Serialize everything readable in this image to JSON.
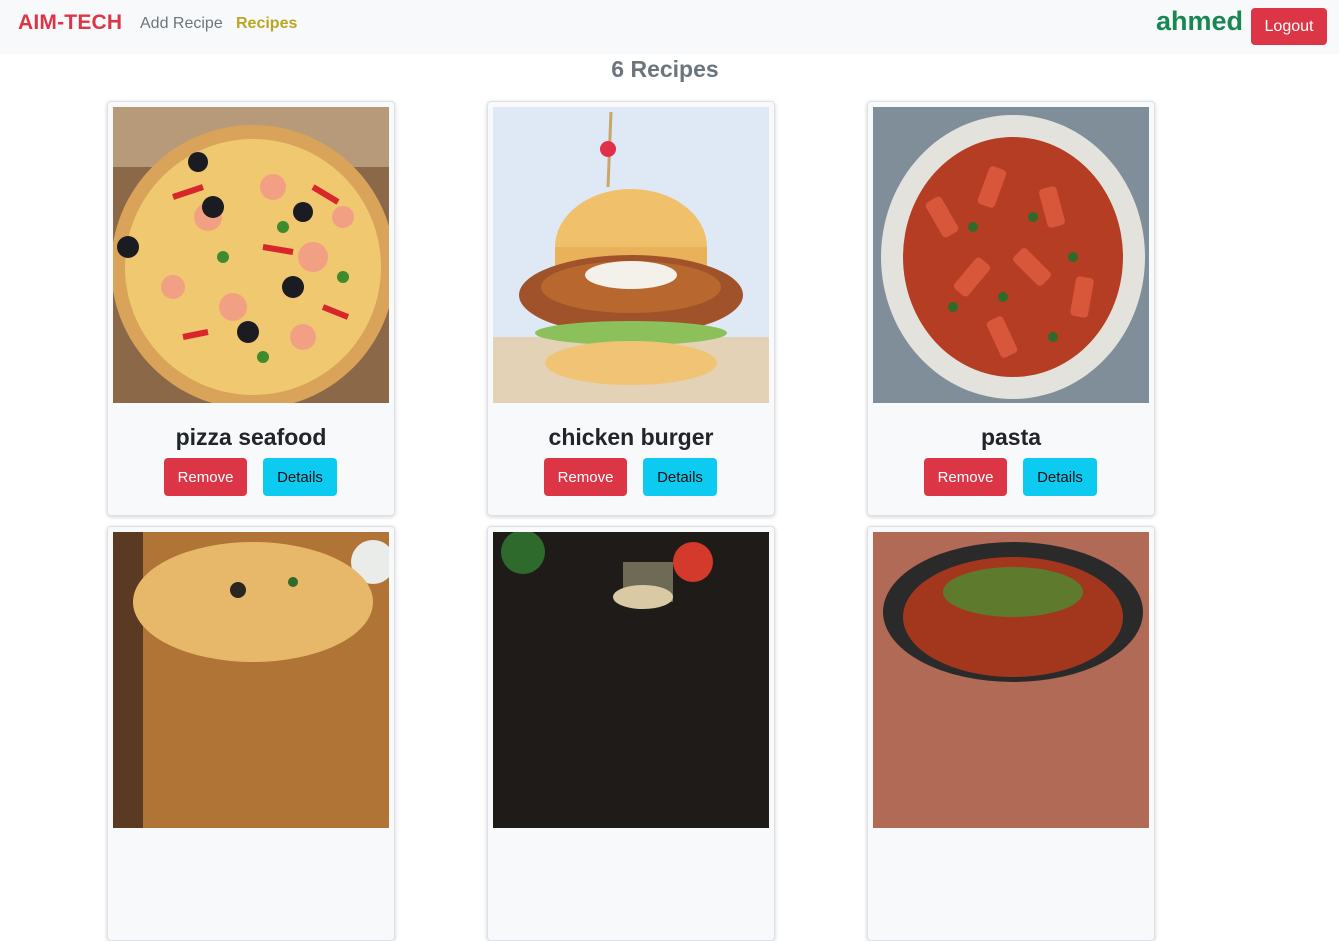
{
  "navbar": {
    "brand": "AIM-TECH",
    "links": [
      {
        "label": "Add Recipe"
      },
      {
        "label": "Recipes"
      }
    ],
    "username": "ahmed",
    "logout_label": "Logout"
  },
  "heading": "6 Recipes",
  "recipes": [
    {
      "title": "pizza seafood",
      "image_icon": "pizza-seafood-photo",
      "remove_label": "Remove",
      "details_label": "Details"
    },
    {
      "title": "chicken burger",
      "image_icon": "chicken-burger-photo",
      "remove_label": "Remove",
      "details_label": "Details"
    },
    {
      "title": "pasta",
      "image_icon": "pasta-photo",
      "remove_label": "Remove",
      "details_label": "Details"
    },
    {
      "title": "",
      "image_icon": "pizza-photo"
    },
    {
      "title": "",
      "image_icon": "wrap-photo"
    },
    {
      "title": "",
      "image_icon": "ratatouille-photo"
    }
  ],
  "colors": {
    "brand": "#dc3545",
    "active_link": "#b8a724",
    "username": "#198754",
    "remove_button": "#dc3545",
    "details_button": "#0dcaf0"
  }
}
